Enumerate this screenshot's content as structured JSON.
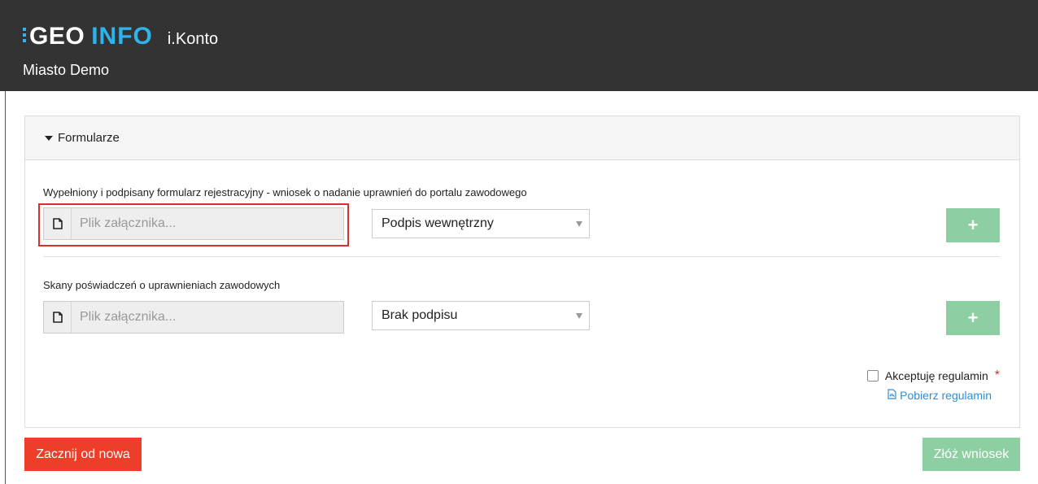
{
  "header": {
    "logo_geo": "GEO",
    "logo_info": "INFO",
    "app_name": "i.Konto",
    "subtitle": "Miasto Demo"
  },
  "panel": {
    "title": "Formularze",
    "fields": [
      {
        "label": "Wypełniony i podpisany formularz rejestracyjny - wniosek o nadanie uprawnień do portalu zawodowego",
        "file_placeholder": "Plik załącznika...",
        "signature_selected": "Podpis wewnętrzny",
        "add_label": "+"
      },
      {
        "label": "Skany poświadczeń o uprawnieniach zawodowych",
        "file_placeholder": "Plik załącznika...",
        "signature_selected": "Brak podpisu",
        "add_label": "+"
      }
    ],
    "accept_label": "Akceptuję regulamin",
    "required_mark": "*",
    "download_label": "Pobierz regulamin"
  },
  "actions": {
    "reset_label": "Zacznij od nowa",
    "submit_label": "Złóż wniosek"
  },
  "colors": {
    "header_bg": "#333333",
    "accent_blue": "#2fb3ea",
    "success_disabled": "#8dcfa3",
    "danger": "#ee3e2a",
    "highlight": "#d9302f",
    "link": "#2b8fd6"
  },
  "icons": {
    "file": "file-icon",
    "caret": "caret-down-icon",
    "pdf": "pdf-file-icon",
    "select_arrow": "chevron-down-icon"
  }
}
